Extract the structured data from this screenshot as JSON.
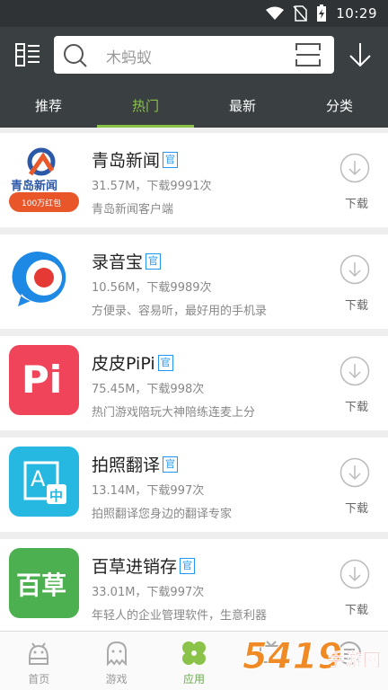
{
  "status_bar": {
    "time": "10:29"
  },
  "search": {
    "placeholder": "木蚂蚁"
  },
  "tabs": [
    {
      "label": "推荐",
      "active": false
    },
    {
      "label": "热门",
      "active": true
    },
    {
      "label": "最新",
      "active": false
    },
    {
      "label": "分类",
      "active": false
    }
  ],
  "apps": [
    {
      "name": "青岛新闻",
      "badge": "官",
      "meta": "31.57M，下载9991次",
      "desc": "青岛新闻客户端",
      "download_label": "下载",
      "icon_text": "青岛新闻",
      "icon_subtext": "100万红包"
    },
    {
      "name": "录音宝",
      "badge": "官",
      "meta": "10.56M，下载9989次",
      "desc": "方便录、容易听，最好用的手机录",
      "download_label": "下载"
    },
    {
      "name": "皮皮PiPi",
      "badge": "官",
      "meta": "75.45M，下载998次",
      "desc": "热门游戏陪玩大神陪练连麦上分",
      "download_label": "下载",
      "icon_text": "Pi"
    },
    {
      "name": "拍照翻译",
      "badge": "官",
      "meta": "13.14M，下载997次",
      "desc": "拍照翻译您身边的翻译专家",
      "download_label": "下载",
      "icon_text": "A",
      "icon_subtext": "中"
    },
    {
      "name": "百草进销存",
      "badge": "官",
      "meta": "33.01M，下载997次",
      "desc": "年轻人的企业管理软件，生意利器",
      "download_label": "下载",
      "icon_text": "百草"
    }
  ],
  "bottom_nav": [
    {
      "label": "首页",
      "icon": "android-icon",
      "active": false
    },
    {
      "label": "游戏",
      "icon": "ghost-icon",
      "active": false
    },
    {
      "label": "应用",
      "icon": "clover-icon",
      "active": true
    },
    {
      "label": "",
      "icon": "tv-icon",
      "active": false
    },
    {
      "label": "",
      "icon": "menu-circle-icon",
      "active": false
    }
  ],
  "watermark": {
    "text": "手游网",
    "number": "5419"
  },
  "colors": {
    "accent": "#8bc34a",
    "header": "#3a3f42",
    "badge": "#2196f3"
  }
}
